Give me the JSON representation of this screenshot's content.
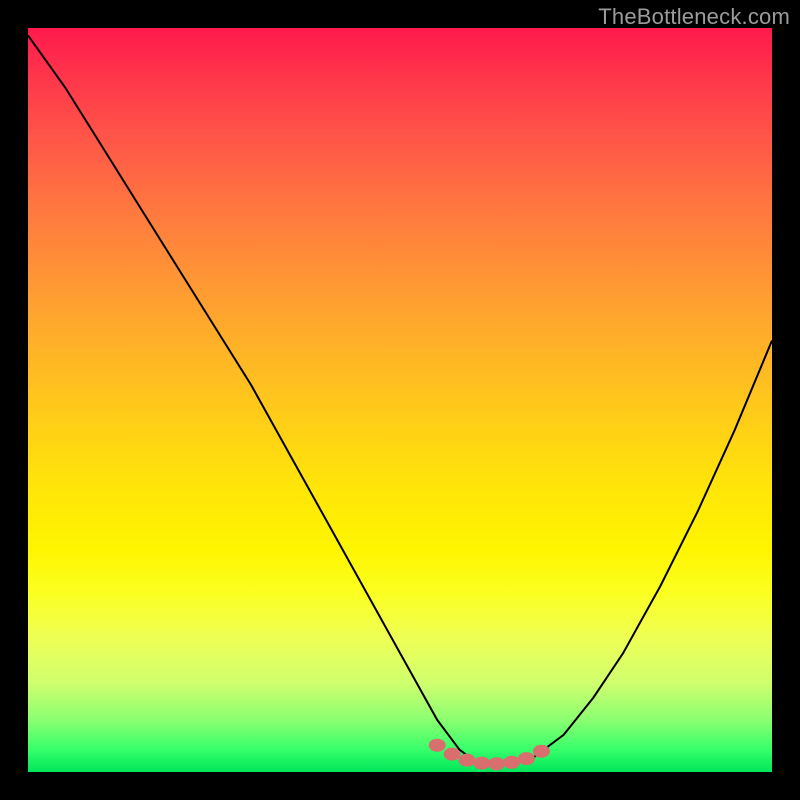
{
  "watermark": "TheBottleneck.com",
  "chart_data": {
    "type": "line",
    "title": "",
    "xlabel": "",
    "ylabel": "",
    "xlim": [
      0,
      100
    ],
    "ylim": [
      0,
      100
    ],
    "series": [
      {
        "name": "curve",
        "x": [
          0,
          5,
          10,
          15,
          20,
          25,
          30,
          35,
          40,
          45,
          50,
          55,
          58,
          60,
          62,
          64,
          66,
          68,
          72,
          76,
          80,
          85,
          90,
          95,
          100
        ],
        "values": [
          99,
          92,
          84,
          76,
          68,
          60,
          52,
          43,
          34,
          25,
          16,
          7,
          3,
          1.5,
          1,
          1,
          1.3,
          2,
          5,
          10,
          16,
          25,
          35,
          46,
          58
        ]
      }
    ],
    "markers": {
      "name": "bottom-markers",
      "x": [
        55,
        57,
        59,
        61,
        63,
        65,
        67,
        69
      ],
      "values": [
        3.6,
        2.4,
        1.6,
        1.2,
        1.1,
        1.3,
        1.8,
        2.8
      ]
    },
    "background_gradient": {
      "direction": "vertical",
      "stops": [
        {
          "pct": 0,
          "color": "#ff1a4d"
        },
        {
          "pct": 50,
          "color": "#ffd414"
        },
        {
          "pct": 75,
          "color": "#fff500"
        },
        {
          "pct": 100,
          "color": "#00e65a"
        }
      ]
    }
  }
}
